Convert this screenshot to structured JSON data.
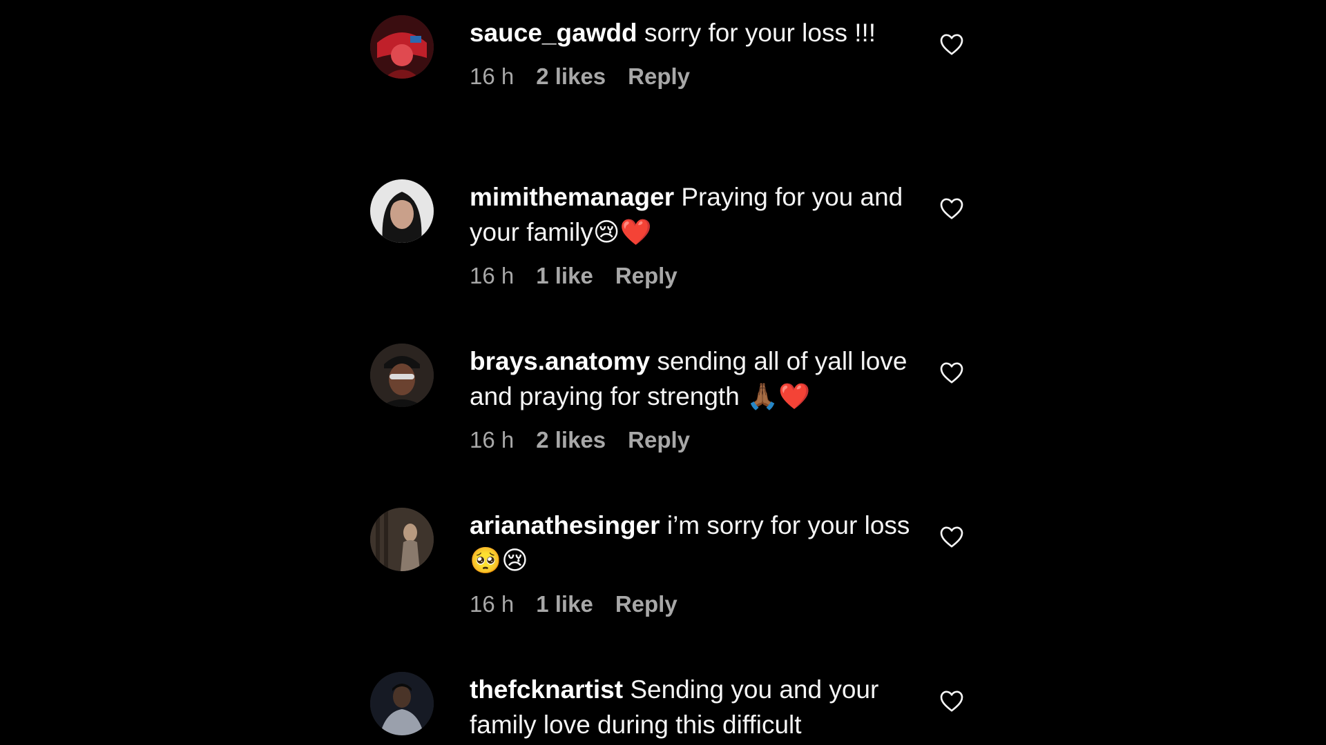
{
  "comments": [
    {
      "username": "sauce_gawdd",
      "text": "sorry for your loss !!!",
      "time": "16 h",
      "likes": "2 likes",
      "reply_label": "Reply",
      "avatar_color": "#c0202a"
    },
    {
      "username": "mimithemanager",
      "text": "Praying for you and your family😢❤️",
      "time": "16 h",
      "likes": "1 like",
      "reply_label": "Reply",
      "avatar_color": "#d8d8d8"
    },
    {
      "username": "brays.anatomy",
      "text": "sending all of yall love and praying for strength 🙏🏾❤️",
      "time": "16 h",
      "likes": "2 likes",
      "reply_label": "Reply",
      "avatar_color": "#3a2c22"
    },
    {
      "username": "arianathesinger",
      "text": "i’m sorry for your loss🥺😢",
      "time": "16 h",
      "likes": "1 like",
      "reply_label": "Reply",
      "avatar_color": "#4a4038"
    },
    {
      "username": "thefcknartist",
      "text": "Sending you and your family love during this difficult",
      "time": "",
      "likes": "",
      "reply_label": "",
      "avatar_color": "#1c2438"
    }
  ],
  "icons": {
    "like": "heart-outline-icon"
  }
}
